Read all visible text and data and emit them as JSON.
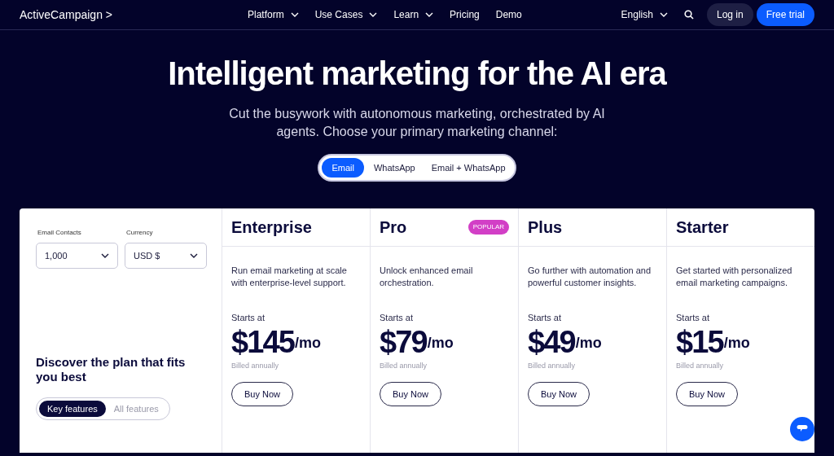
{
  "nav": {
    "logo": "ActiveCampaign >",
    "menu": [
      {
        "label": "Platform",
        "dropdown": true
      },
      {
        "label": "Use Cases",
        "dropdown": true
      },
      {
        "label": "Learn",
        "dropdown": true
      },
      {
        "label": "Pricing",
        "dropdown": false
      },
      {
        "label": "Demo",
        "dropdown": false
      }
    ],
    "language": "English",
    "login": "Log in",
    "cta": "Free trial"
  },
  "hero": {
    "title": "Intelligent marketing for the AI era",
    "subtitle": "Cut the busywork with autonomous marketing, orchestrated by AI agents. Choose your primary marketing channel:"
  },
  "channels": [
    {
      "label": "Email",
      "selected": true
    },
    {
      "label": "WhatsApp",
      "selected": false
    },
    {
      "label": "Email + WhatsApp",
      "selected": false
    }
  ],
  "filters": [
    {
      "label": "Email Contacts",
      "value": "1,000"
    },
    {
      "label": "Currency",
      "value": "USD $"
    }
  ],
  "discover": "Discover the plan that fits you best",
  "feature_tabs": [
    {
      "label": "Key features",
      "selected": true
    },
    {
      "label": "All features",
      "selected": false
    }
  ],
  "plans": [
    {
      "name": "Enterprise",
      "description": "Run email marketing at scale with enterprise-level support.",
      "starts": "Starts at",
      "price": "$145",
      "unit": "/mo",
      "billing": "Billed annually",
      "button": "Buy Now"
    },
    {
      "name": "Pro",
      "badge": "POPULAR",
      "description": "Unlock enhanced email orchestration.",
      "starts": "Starts at",
      "price": "$79",
      "unit": "/mo",
      "billing": "Billed annually",
      "button": "Buy Now"
    },
    {
      "name": "Plus",
      "description": "Go further with automation and powerful customer insights.",
      "starts": "Starts at",
      "price": "$49",
      "unit": "/mo",
      "billing": "Billed annually",
      "button": "Buy Now"
    },
    {
      "name": "Starter",
      "description": "Get started with personalized email marketing campaigns.",
      "starts": "Starts at",
      "price": "$15",
      "unit": "/mo",
      "billing": "Billed annually",
      "button": "Buy Now"
    }
  ]
}
